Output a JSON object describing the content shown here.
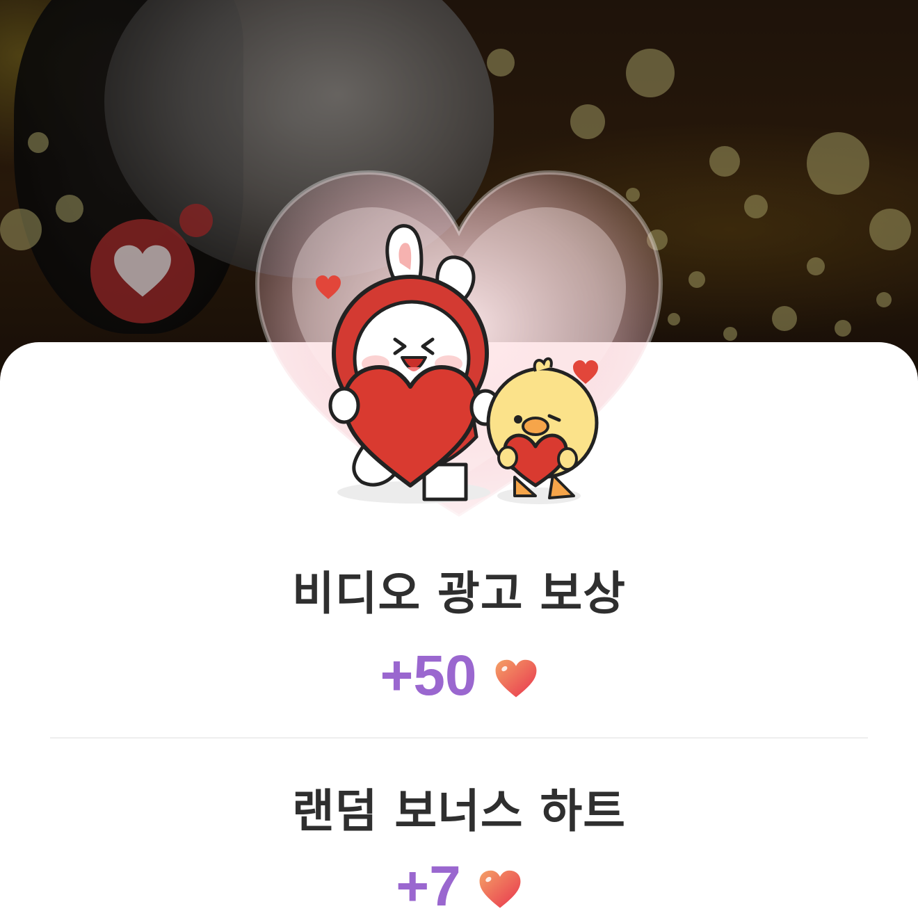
{
  "reward": {
    "title": "비디오 광고 보상",
    "amount": "+50",
    "currency_icon": "heart-icon"
  },
  "bonus": {
    "title": "랜덤 보너스 하트",
    "amount": "+7",
    "currency_icon": "heart-icon"
  },
  "colors": {
    "amount": "#9a67cf",
    "title": "#2f2f2f",
    "heart_gradient_start": "#f08a5b",
    "heart_gradient_end": "#e8344e",
    "sheet": "#ffffff"
  },
  "illustration": {
    "name": "rabbit-and-chick-holding-hearts"
  }
}
